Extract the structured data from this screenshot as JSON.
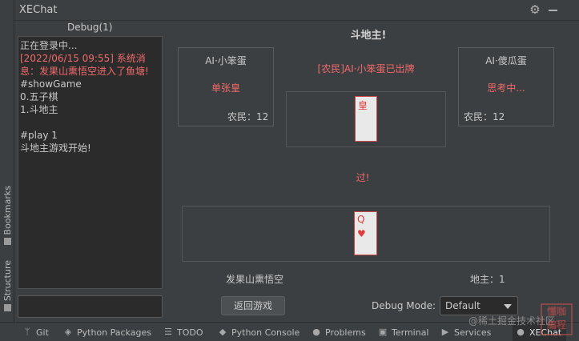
{
  "window": {
    "title": "XEChat"
  },
  "left_stripe": {
    "bookmarks": "Bookmarks",
    "structure": "Structure"
  },
  "debug": {
    "title": "Debug(1)",
    "lines": [
      {
        "text": "正在登录中...",
        "kind": "normal"
      },
      {
        "text": "[2022/06/15 09:55] 系统消息：发果山熏悟空进入了鱼塘!",
        "kind": "sys"
      },
      {
        "text": "#showGame",
        "kind": "normal"
      },
      {
        "text": "0.五子棋",
        "kind": "normal"
      },
      {
        "text": "1.斗地主",
        "kind": "normal"
      },
      {
        "text": "",
        "kind": "normal"
      },
      {
        "text": "#play 1",
        "kind": "normal"
      },
      {
        "text": "斗地主游戏开始!",
        "kind": "normal"
      }
    ],
    "input_value": ""
  },
  "game": {
    "title": "斗地主!",
    "left_player": {
      "name": "AI·小笨蛋",
      "status": "单张皇",
      "role": "农民：12"
    },
    "right_player": {
      "name": "AI·傻瓜蛋",
      "status": "思考中...",
      "role": "农民：12"
    },
    "center_message": "[农民]AI·小笨蛋已出牌",
    "played_card": {
      "rank": "皇"
    },
    "pass_message": "过!",
    "hand_card": {
      "rank": "Q",
      "suit": "♥"
    },
    "self_name": "发果山熏悟空",
    "self_role": "地主：1",
    "back_button": "返回游戏",
    "debug_mode_label": "Debug Mode:",
    "debug_mode_value": "Default"
  },
  "bottom_tabs": [
    {
      "label": "Git",
      "icon": "branch-icon"
    },
    {
      "label": "Python Packages",
      "icon": "layers-icon"
    },
    {
      "label": "TODO",
      "icon": "list-icon"
    },
    {
      "label": "Python Console",
      "icon": "python-icon"
    },
    {
      "label": "Problems",
      "icon": "info-icon"
    },
    {
      "label": "Terminal",
      "icon": "terminal-icon"
    },
    {
      "label": "Services",
      "icon": "play-icon"
    },
    {
      "label": "XEChat",
      "icon": "chat-icon",
      "active": true
    }
  ],
  "watermark": {
    "text": "@稀土掘金技术社区",
    "logo": "懂咖 编程"
  },
  "colors": {
    "accent_red": "#f06a6a",
    "background": "#3c3f41",
    "panel": "#2b2b2b"
  }
}
